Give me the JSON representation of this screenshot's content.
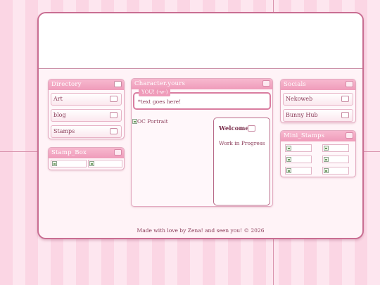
{
  "directory": {
    "title": "Directory",
    "items": [
      {
        "label": "Art"
      },
      {
        "label": "blog"
      },
      {
        "label": "Stamps"
      }
    ]
  },
  "stamp_box": {
    "title": "Stamp_Box"
  },
  "center": {
    "title": "Character.yours",
    "you_label": "YOU! (-w-)",
    "speech_text": "*text goes here!",
    "portrait_alt": "OC Portrait",
    "welcome_title": "Welcome!",
    "welcome_body": "Work in Progress"
  },
  "social": {
    "title": "Socials",
    "items": [
      {
        "label": "Nekoweb"
      },
      {
        "label": "Bunny Hub"
      }
    ]
  },
  "mini_stamps": {
    "title": "Mini_Stamps"
  },
  "footer": {
    "text": "Made with love by Zena! and seen you! © 2026"
  },
  "colors": {
    "accent": "#ef9cba",
    "text": "#8a3b58",
    "frame_border": "#c96e92",
    "background_stripe_a": "#fbd6e4",
    "background_stripe_b": "#fde6ef"
  },
  "icons": {
    "directory_title_button": "grid-icon",
    "item_checkbox": "checkbox-icon",
    "broken_image": "broken-image-icon"
  }
}
